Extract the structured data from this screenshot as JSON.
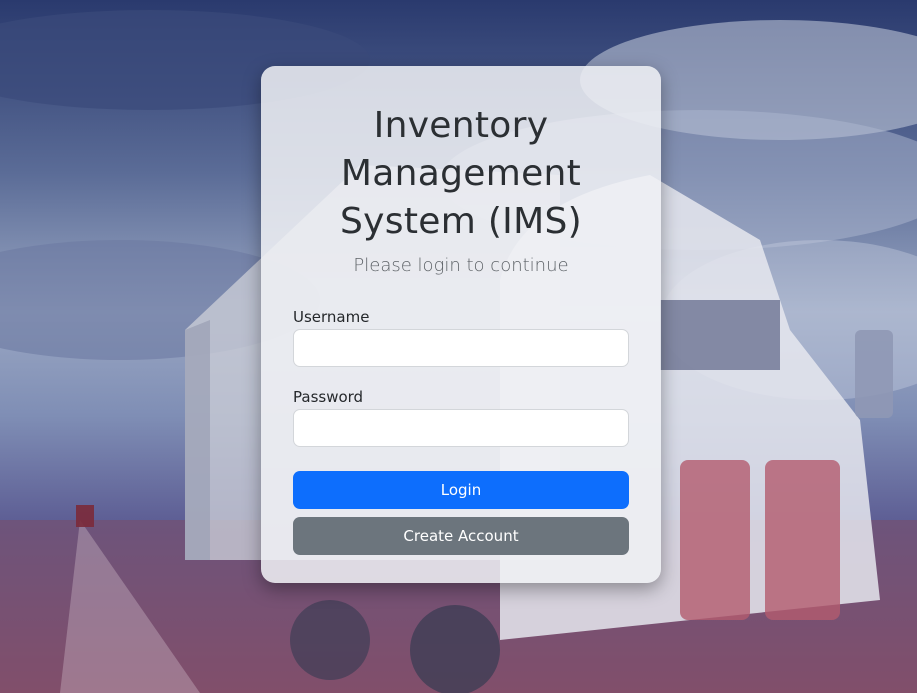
{
  "login_card": {
    "title": "Inventory Management System (IMS)",
    "subtitle": "Please login to continue",
    "username_label": "Username",
    "username_value": "",
    "password_label": "Password",
    "password_value": "",
    "login_label": "Login",
    "create_account_label": "Create Account"
  },
  "colors": {
    "primary_button": "#0d6efd",
    "secondary_button": "#6c757d",
    "card_background": "#f0f1f4"
  }
}
